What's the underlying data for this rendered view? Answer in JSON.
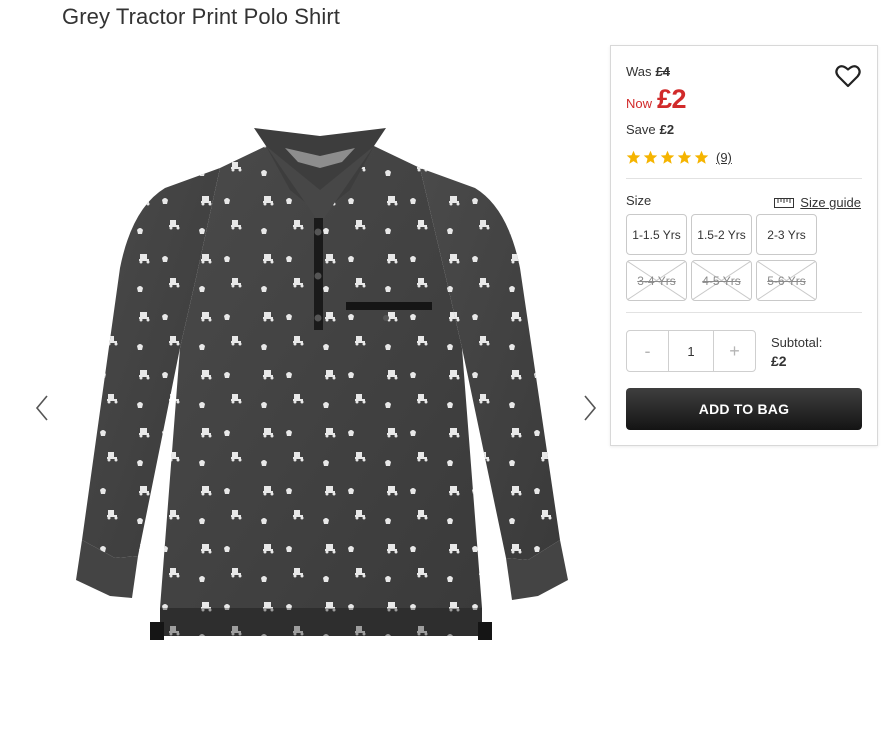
{
  "product": {
    "title": "Grey Tractor Print Polo Shirt",
    "image_alt": "grey-tractor-print-polo-shirt"
  },
  "pricing": {
    "was_label": "Was",
    "was_price": "£4",
    "now_label": "Now",
    "now_price": "£2",
    "save_label": "Save",
    "save_amount": "£2",
    "price_color": "#d12a2a"
  },
  "rating": {
    "stars": 5,
    "max_stars": 5,
    "review_count": "(9)",
    "star_color": "#f5b400"
  },
  "size": {
    "label": "Size",
    "guide_label": "Size guide",
    "guide_icon": "ruler-icon",
    "options": [
      {
        "label": "1-1.5 Yrs",
        "available": true
      },
      {
        "label": "1.5-2 Yrs",
        "available": true
      },
      {
        "label": "2-3 Yrs",
        "available": true
      },
      {
        "label": "3-4 Yrs",
        "available": false
      },
      {
        "label": "4-5 Yrs",
        "available": false
      },
      {
        "label": "5-6 Yrs",
        "available": false
      }
    ]
  },
  "quantity": {
    "minus": "-",
    "value": "1",
    "plus": "+"
  },
  "subtotal": {
    "label": "Subtotal:",
    "value": "£2"
  },
  "actions": {
    "add_to_bag": "ADD TO BAG",
    "favourite_icon": "heart-icon",
    "prev_icon": "chevron-left-icon",
    "next_icon": "chevron-right-icon"
  }
}
